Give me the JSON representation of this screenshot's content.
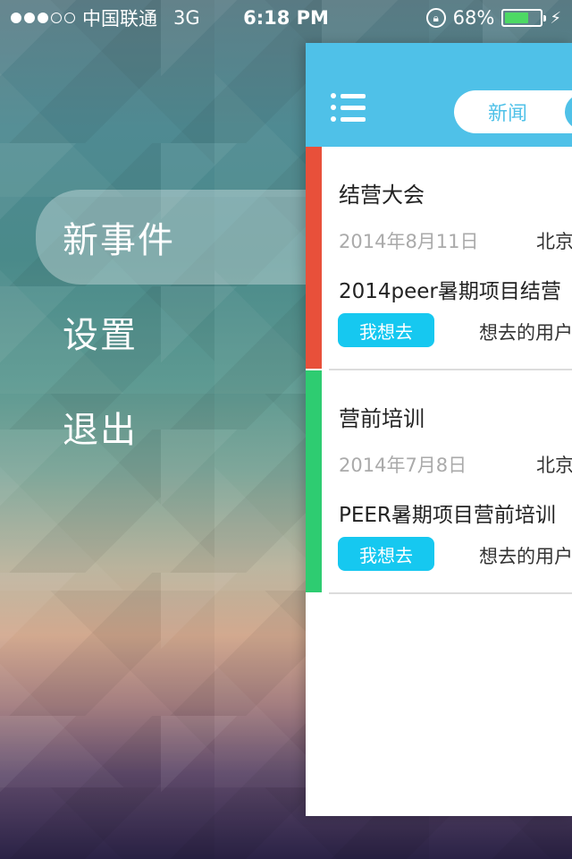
{
  "status_bar": {
    "signal_dots_filled": 3,
    "signal_dots_total": 5,
    "carrier": "中国联通",
    "network": "3G",
    "time": "6:18 PM",
    "battery": "68%",
    "battery_level": 0.68
  },
  "menu": {
    "items": [
      {
        "label": "新事件",
        "active": true
      },
      {
        "label": "设置",
        "active": false
      },
      {
        "label": "退出",
        "active": false
      }
    ]
  },
  "panel": {
    "header_color": "#4fc1e8",
    "tabs": [
      "新闻"
    ],
    "events": [
      {
        "title": "结营大会",
        "date": "2014年8月11日",
        "place": "北京",
        "description": "2014peer暑期项目结营",
        "button": "我想去",
        "users_text": "想去的用户",
        "stripe_color": "#e8503a"
      },
      {
        "title": "营前培训",
        "date": "2014年7月8日",
        "place": "北京",
        "description": "PEER暑期项目营前培训",
        "button": "我想去",
        "users_text": "想去的用户",
        "stripe_color": "#2ecc71"
      }
    ]
  }
}
